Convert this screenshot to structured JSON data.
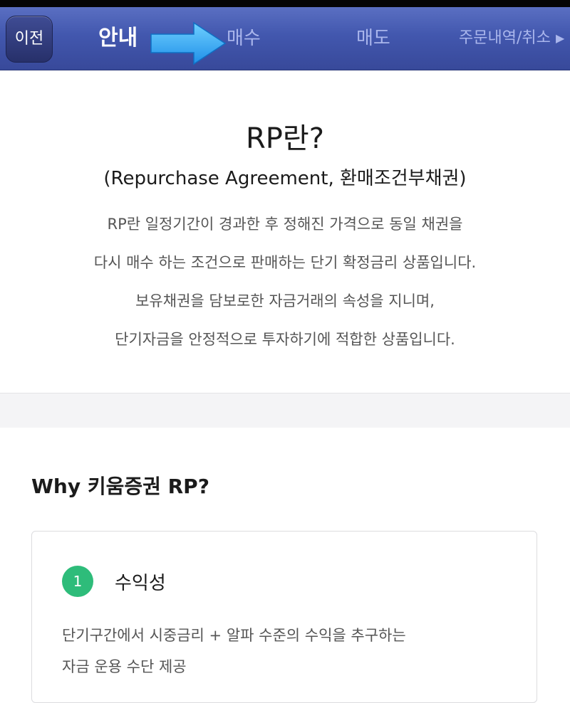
{
  "nav": {
    "back_label": "이전",
    "tabs": [
      {
        "label": "안내",
        "active": true
      },
      {
        "label": "매수",
        "active": false
      },
      {
        "label": "매도",
        "active": false
      },
      {
        "label": "주문내역/취소",
        "active": false
      }
    ],
    "more_glyph": "▶",
    "colors": {
      "bar": "#4257ae",
      "active_text": "#ffffff",
      "inactive_text": "#aab6ec",
      "arrow": "#1f9bf0"
    }
  },
  "intro": {
    "title": "RP란?",
    "subtitle": "(Repurchase Agreement, 환매조건부채권)",
    "lines": [
      "RP란 일정기간이 경과한 후 정해진 가격으로 동일 채권을",
      "다시 매수 하는 조건으로 판매하는 단기 확정금리 상품입니다.",
      "보유채권을 담보로한 자금거래의 속성을 지니며,",
      "단기자금을 안정적으로 투자하기에 적합한 상품입니다."
    ]
  },
  "why": {
    "title": "Why 키움증권 RP?",
    "card": {
      "number": "1",
      "title": "수익성",
      "lines": [
        "단기구간에서 시중금리 + 알파 수준의 수익을 추구하는",
        "자금 운용 수단 제공"
      ],
      "badge_color": "#2ebc7a"
    }
  }
}
